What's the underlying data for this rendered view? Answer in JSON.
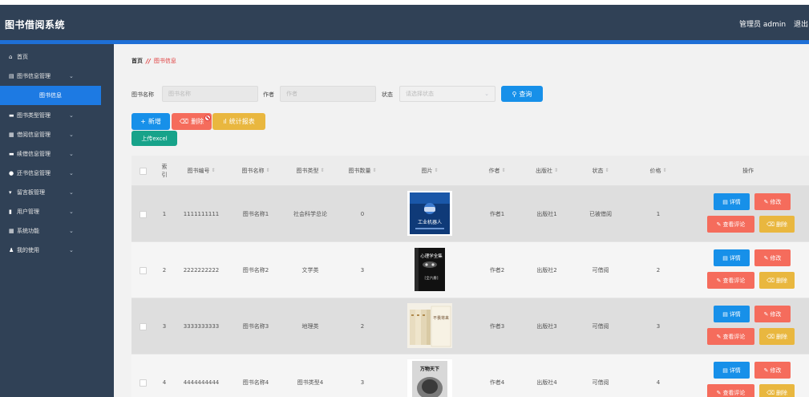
{
  "header": {
    "title": "图书借阅系统",
    "user": "管理员 admin",
    "logout": "退出"
  },
  "sidebar": {
    "items": [
      {
        "label": "首页",
        "icon": "home-icon"
      },
      {
        "label": "图书信息管理",
        "icon": "book-icon"
      },
      {
        "label": "图书信息",
        "active": true
      },
      {
        "label": "图书类型管理",
        "icon": "category-icon"
      },
      {
        "label": "借阅信息管理",
        "icon": "grid-icon"
      },
      {
        "label": "续借信息管理",
        "icon": "renew-icon"
      },
      {
        "label": "还书信息管理",
        "icon": "return-icon"
      },
      {
        "label": "留言板管理",
        "icon": "message-icon"
      },
      {
        "label": "用户管理",
        "icon": "user-icon"
      },
      {
        "label": "系统功能",
        "icon": "grid-icon"
      },
      {
        "label": "我的使用",
        "icon": "person-icon"
      }
    ]
  },
  "breadcrumb": {
    "home": "首页",
    "separator": "//",
    "current": "图书信息"
  },
  "filters": {
    "book_name_label": "图书名称",
    "book_name_placeholder": "图书名称",
    "author_label": "作者",
    "author_placeholder": "作者",
    "status_label": "状态",
    "status_placeholder": "请选择状态",
    "query_label": "查询"
  },
  "toolbar": {
    "add": "新增",
    "delete": "删除",
    "stats": "统计报表",
    "upload": "上传excel"
  },
  "table": {
    "headers": [
      "索引",
      "图书编号",
      "图书名称",
      "图书类型",
      "图书数量",
      "图片",
      "作者",
      "出版社",
      "状态",
      "价格",
      "操作"
    ],
    "rows": [
      {
        "index": "1",
        "code": "1111111111",
        "name": "图书名称1",
        "type": "社会科学总论",
        "qty": "0",
        "author": "作者1",
        "publisher": "出版社1",
        "status": "已被借阅",
        "price": "1"
      },
      {
        "index": "2",
        "code": "2222222222",
        "name": "图书名称2",
        "type": "文学类",
        "qty": "3",
        "author": "作者2",
        "publisher": "出版社2",
        "status": "可借阅",
        "price": "2"
      },
      {
        "index": "3",
        "code": "3333333333",
        "name": "图书名称3",
        "type": "地理类",
        "qty": "2",
        "author": "作者3",
        "publisher": "出版社3",
        "status": "可借阅",
        "price": "3"
      },
      {
        "index": "4",
        "code": "4444444444",
        "name": "图书名称4",
        "type": "图书类型4",
        "qty": "3",
        "author": "作者4",
        "publisher": "出版社4",
        "status": "可借阅",
        "price": "4"
      }
    ],
    "actions": {
      "detail": "详情",
      "edit": "修改",
      "comments": "查看评论",
      "delete": "删除"
    },
    "covers": [
      {
        "lines": [
          "工业机器人"
        ]
      },
      {
        "lines": [
          "心理学全集",
          "[全六册]"
        ]
      },
      {
        "lines": [
          "不畏将来"
        ]
      },
      {
        "lines": [
          "万物天下"
        ]
      }
    ]
  },
  "colors": {
    "header_bg": "#304156",
    "primary": "#1790e9",
    "danger": "#f56c5c",
    "warning": "#e9b73f",
    "success": "#17a38a"
  }
}
